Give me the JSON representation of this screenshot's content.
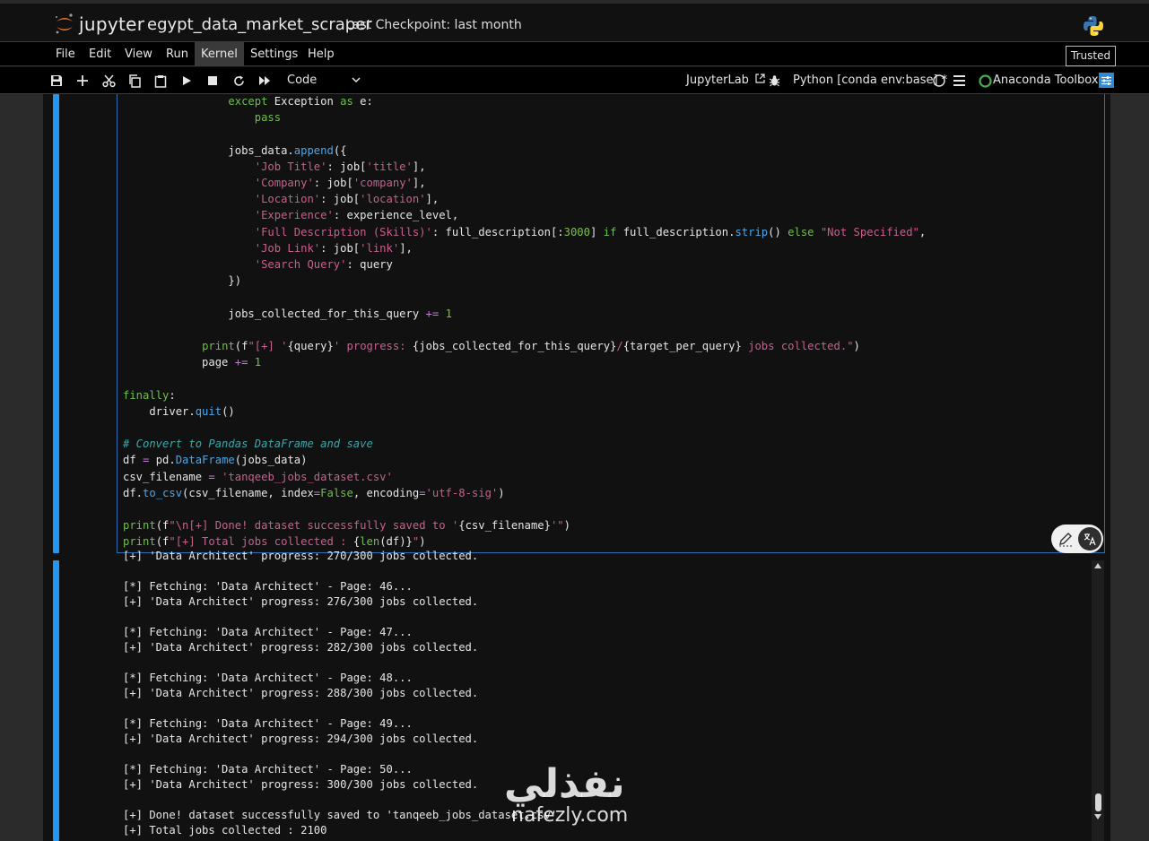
{
  "header": {
    "logo_text": "jupyter",
    "notebook_title": "egypt_data_market_scraper",
    "checkpoint": "Last Checkpoint: last month"
  },
  "menu": {
    "items": [
      "File",
      "Edit",
      "View",
      "Run",
      "Kernel",
      "Settings",
      "Help"
    ],
    "active": "Kernel",
    "trusted": "Trusted"
  },
  "toolbar": {
    "cell_type": "Code",
    "jupyterlab": "JupyterLab",
    "kernel": "Python [conda env:base] *",
    "toolbox": "Anaconda Toolbox"
  },
  "code_lines": [
    "                except Exception as e:",
    "                    pass",
    "",
    "                jobs_data.append({",
    "                    'Job Title': job['title'],",
    "                    'Company': job['company'],",
    "                    'Location': job['location'],",
    "                    'Experience': experience_level,",
    "                    'Full Description (Skills)': full_description[:3000] if full_description.strip() else \"Not Specified\",",
    "                    'Job Link': job['link'],",
    "                    'Search Query': query",
    "                })",
    "",
    "                jobs_collected_for_this_query += 1",
    "",
    "            print(f\"[+] '{query}' progress: {jobs_collected_for_this_query}/{target_per_query} jobs collected.\")",
    "            page += 1",
    "",
    "finally:",
    "    driver.quit()",
    "",
    "# Convert to Pandas DataFrame and save",
    "df = pd.DataFrame(jobs_data)",
    "csv_filename = 'tanqeeb_jobs_dataset.csv'",
    "df.to_csv(csv_filename, index=False, encoding='utf-8-sig')",
    "",
    "print(f\"\\n[+] Done! dataset successfully saved to '{csv_filename}'\")",
    "print(f\"[+] Total jobs collected : {len(df)}\")"
  ],
  "output_lines": [
    "[+] 'Data Architect' progress: 270/300 jobs collected.",
    "",
    "[*] Fetching: 'Data Architect' - Page: 46...",
    "[+] 'Data Architect' progress: 276/300 jobs collected.",
    "",
    "[*] Fetching: 'Data Architect' - Page: 47...",
    "[+] 'Data Architect' progress: 282/300 jobs collected.",
    "",
    "[*] Fetching: 'Data Architect' - Page: 48...",
    "[+] 'Data Architect' progress: 288/300 jobs collected.",
    "",
    "[*] Fetching: 'Data Architect' - Page: 49...",
    "[+] 'Data Architect' progress: 294/300 jobs collected.",
    "",
    "[*] Fetching: 'Data Architect' - Page: 50...",
    "[+] 'Data Architect' progress: 300/300 jobs collected.",
    "",
    "[+] Done! dataset successfully saved to 'tanqeeb_jobs_dataset.csv'",
    "[+] Total jobs collected : 2100"
  ],
  "watermark": {
    "arabic": "نفذلي",
    "latin": "nafezly.com"
  },
  "colors": {
    "accent": "#2196f3",
    "keyword": "#6fbf4f",
    "string": "#c7608d",
    "function": "#4ea6e6",
    "comment": "#3ea7a7"
  }
}
